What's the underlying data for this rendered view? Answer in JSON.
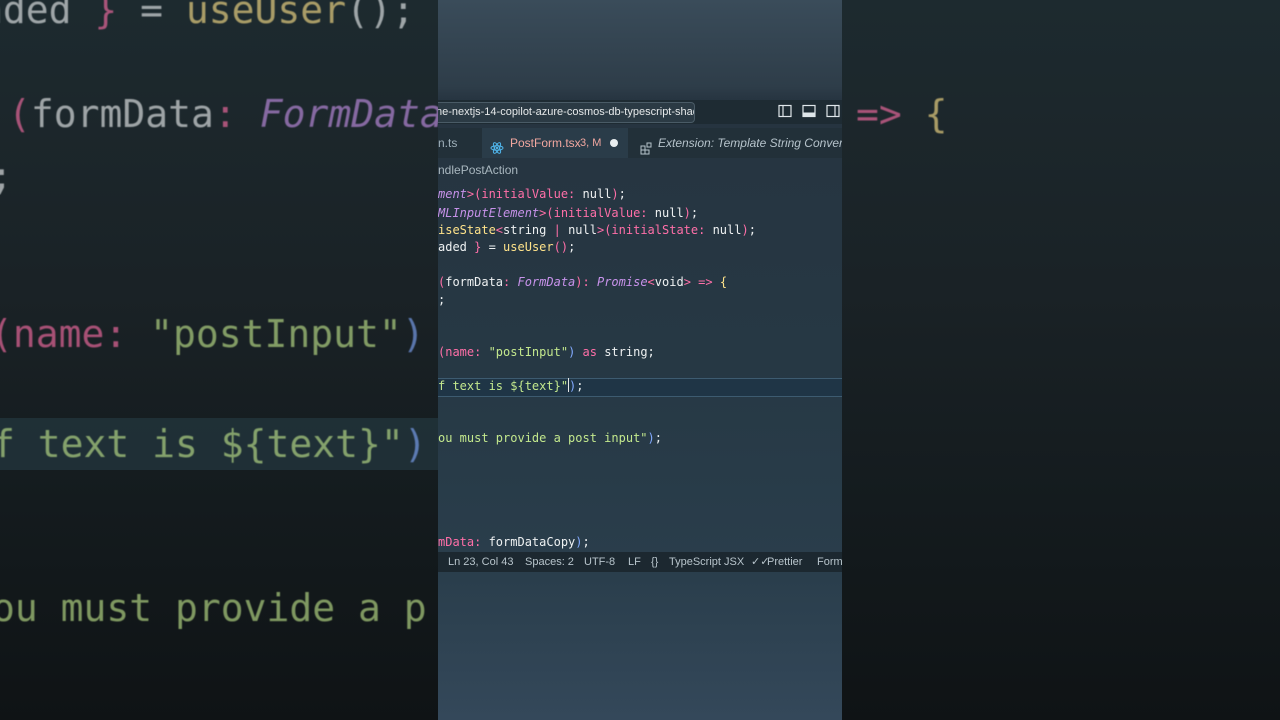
{
  "window": {
    "title": "ne-nextjs-14-copilot-azure-cosmos-db-typescript-shad"
  },
  "tabs": [
    {
      "label": "n.ts"
    },
    {
      "label": "PostForm.tsx",
      "meta": "3, M",
      "modified": true
    },
    {
      "label": "Extension: Template String Converter"
    }
  ],
  "breadcrumb": "ndlePostAction",
  "code_lines": [
    "ment>(initialValue: null);",
    "MLInputElement>(initialValue: null);",
    "iseState<string | null>(initialState: null);",
    "aded } = useUser();",
    "",
    "(formData: FormData): Promise<void> => {",
    ";",
    "",
    "",
    "(name: \"postInput\") as string;",
    "",
    "f text is ${text}\");",
    "",
    "",
    "ou must provide a post input\");",
    "",
    "",
    "",
    "",
    "",
    "mData: formDataCopy);"
  ],
  "statusbar": {
    "position": "Ln 23, Col 43",
    "spaces": "Spaces: 2",
    "encoding": "UTF-8",
    "eol": "LF",
    "language": "TypeScript JSX",
    "formatter": "Prettier",
    "trailing": "Form"
  },
  "backdrop": {
    "left": [
      "aded } = useUser();",
      "(formData: FormData",
      ";",
      "(name: \"postInput\")",
      "f text is ${text}\")",
      "ou must provide a p"
    ],
    "right": "=> {"
  },
  "colors": {
    "keyword": "#ff6fa8",
    "type": "#c792ea",
    "function": "#ffe38a",
    "string": "#c3e88d",
    "accent": "#2a3c49"
  }
}
